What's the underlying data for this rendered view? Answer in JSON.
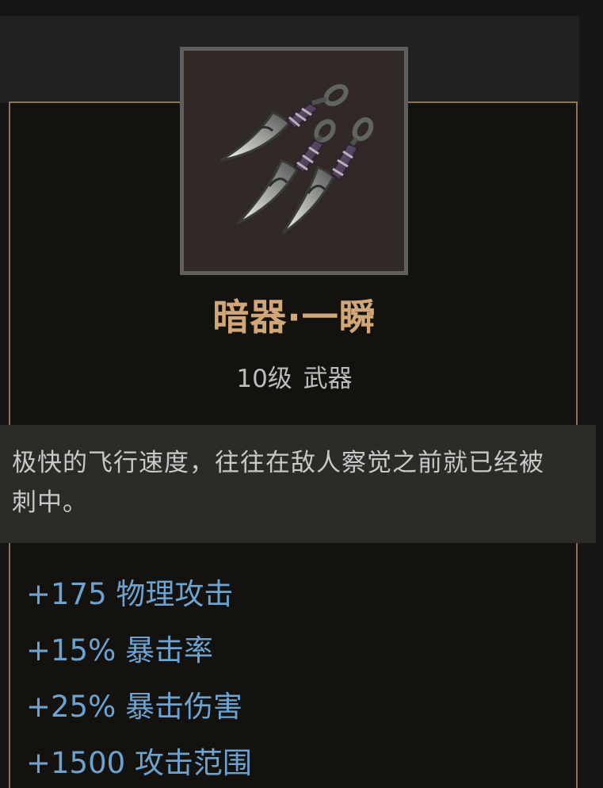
{
  "item": {
    "name": "暗器·一瞬",
    "level_type": "10级 武器",
    "icon": "throwing-knives-icon",
    "description": "极快的飞行速度，往往在敌人察觉之前就已经被刺中。"
  },
  "stats": [
    "+175 物理攻击",
    "+15% 暴击率",
    "+25% 暴击伤害",
    "+1500 攻击范围"
  ],
  "colors": {
    "background": "#151515",
    "card_border": "#8a7757",
    "card_background": "#13120f",
    "item_name": "#d2a777",
    "meta_text": "#bcbcbc",
    "description_background": "#2c2b28",
    "stat_text": "#6ca3d1"
  }
}
